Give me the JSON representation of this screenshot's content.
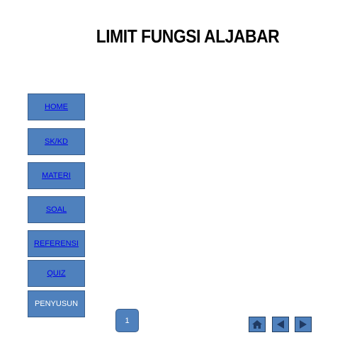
{
  "slide": {
    "title": "LIMIT FUNGSI ALJABAR",
    "page_number": "1"
  },
  "nav": {
    "items": [
      {
        "label": "HOME",
        "link": true
      },
      {
        "label": "SK/KD",
        "link": true
      },
      {
        "label": "MATERI",
        "link": true
      },
      {
        "label": "SOAL",
        "link": true
      },
      {
        "label": "REFERENSI",
        "link": true
      },
      {
        "label": "QUIZ",
        "link": true
      },
      {
        "label": "PENYUSUN",
        "link": false
      }
    ]
  },
  "controls": {
    "icons": [
      "home-icon",
      "previous-icon",
      "next-icon"
    ]
  },
  "colors": {
    "button_fill": "#4f81bd",
    "button_border": "#385d8a",
    "link_text": "#0000ee",
    "control_icon": "#1f3a63"
  }
}
